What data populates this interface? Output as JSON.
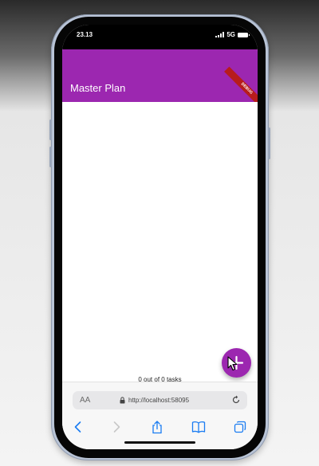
{
  "status_bar": {
    "time": "23.13",
    "network": "5G"
  },
  "app_bar": {
    "title": "Master Plan",
    "debug_banner": "DEBUG"
  },
  "summary": {
    "text": "0 out of 0 tasks"
  },
  "fab": {
    "icon": "add-icon"
  },
  "browser": {
    "text_size_label": "AA",
    "url": "http://localhost:58095",
    "toolbar_icons": [
      "back-icon",
      "forward-icon",
      "share-icon",
      "bookmarks-icon",
      "tabs-icon"
    ]
  },
  "colors": {
    "app_bar": "#9c27b0",
    "fab": "#9c27b0",
    "debug_banner": "#b71c1c",
    "ios_blue": "#1a7cf2"
  }
}
